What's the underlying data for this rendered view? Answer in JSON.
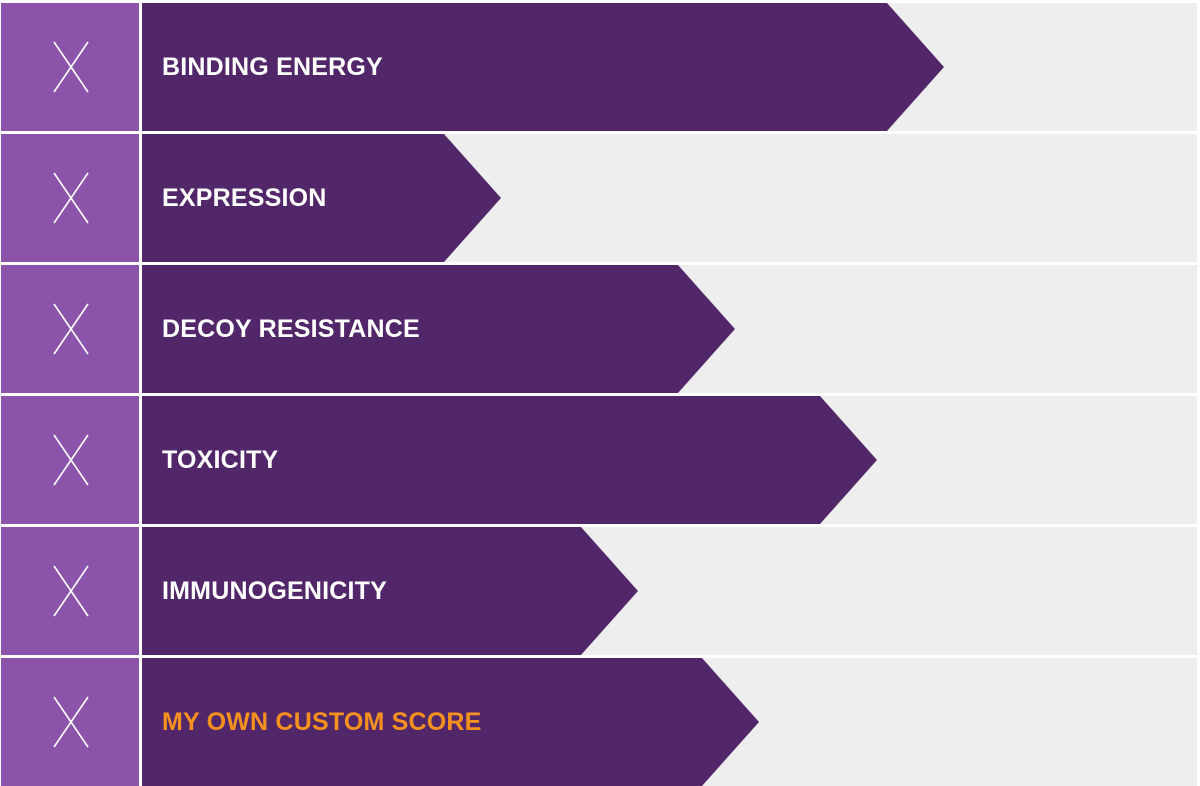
{
  "colors": {
    "x_box": "#8b54aa",
    "bar": "#522769",
    "track": "#eeeeee",
    "label": "#ffffff",
    "custom_label": "#f6901e"
  },
  "items": [
    {
      "label": "BINDING ENERGY",
      "remove_icon": "close-icon"
    },
    {
      "label": "EXPRESSION",
      "remove_icon": "close-icon"
    },
    {
      "label": "DECOY RESISTANCE",
      "remove_icon": "close-icon"
    },
    {
      "label": "TOXICITY",
      "remove_icon": "close-icon"
    },
    {
      "label": "IMMUNOGENICITY",
      "remove_icon": "close-icon"
    },
    {
      "label": "MY OWN CUSTOM SCORE",
      "remove_icon": "close-icon"
    }
  ]
}
